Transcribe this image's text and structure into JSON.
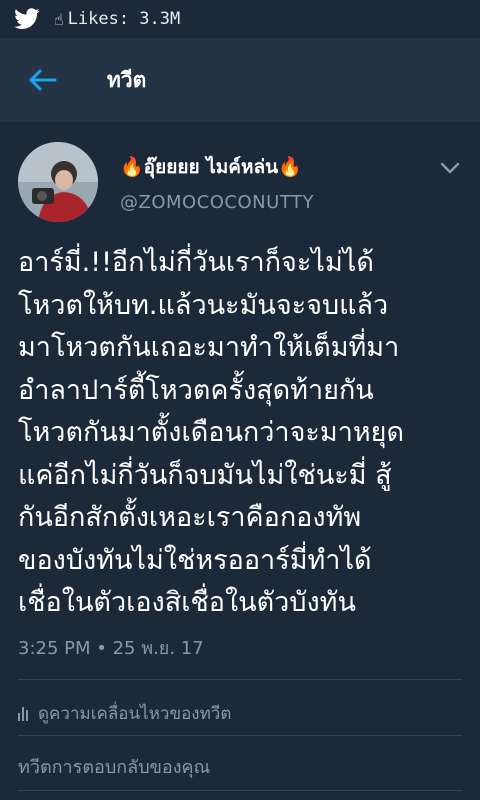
{
  "status_bar": {
    "likes_hand": "☝",
    "likes_text": "Likes: 3.3M",
    "twitter_icon": "twitter-bird-icon"
  },
  "nav": {
    "title": "ทวีต",
    "back_icon": "arrow-left-icon"
  },
  "tweet": {
    "display_name": "🔥อุ๊ยยยย ไมค์หล่น🔥",
    "handle": "@ZOMOCOCONUTTY",
    "text": "อาร์มี่.!!อีกไม่กี่วันเราก็จะไม่ได้\nโหวตให้บท.แล้วนะมันจะจบแล้ว\nมาโหวตกันเถอะมาทำให้เต็มที่มา\nอำลาปาร์ตี้โหวตครั้งสุดท้ายกัน\nโหวตกันมาตั้งเดือนกว่าจะมาหยุด\nแค่อีกไม่กี่วันก็จบมันไม่ใช่นะมี่ สู้\nกันอีกสักตั้งเหอะเราคือกองทัพ\nของบังทันไม่ใช่หรออาร์มี่ทำได้\nเชื่อในตัวเองสิเชื่อในตัวบังทัน",
    "timestamp": "3:25 PM • 25 พ.ย. 17"
  },
  "activity": {
    "label": "ดูความเคลื่อนไหวของทวีต"
  },
  "reply": {
    "placeholder": "ทวีตการตอบกลับของคุณ"
  },
  "colors": {
    "background": "#1c2938",
    "navbar": "#243447",
    "accent": "#1da1f2",
    "secondary_text": "#8899a6",
    "divider": "#38444d"
  }
}
